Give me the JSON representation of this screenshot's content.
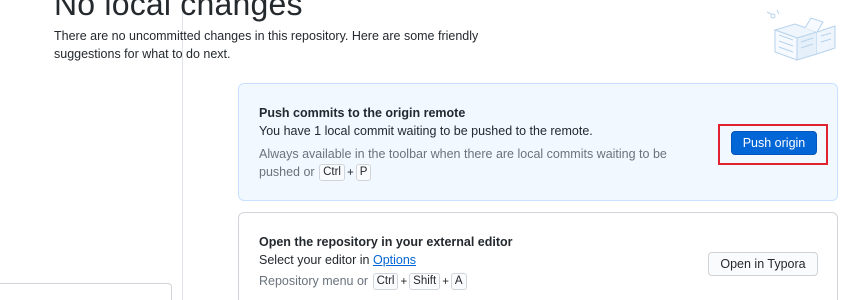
{
  "blank_slate": {
    "heading": "No local changes",
    "intro": "There are no uncommitted changes in this repository. Here are some friendly suggestions for what to do next."
  },
  "push_card": {
    "title": "Push commits to the origin remote",
    "description": "You have 1 local commit waiting to be pushed to the remote.",
    "hint_prefix": "Always available in the toolbar when there are local commits waiting to be pushed or",
    "shortcut_keys": [
      "Ctrl",
      "P"
    ],
    "button_label": "Push origin"
  },
  "editor_card": {
    "title": "Open the repository in your external editor",
    "select_prefix": "Select your editor in",
    "options_link": "Options",
    "menu_prefix": "Repository menu or",
    "shortcut_keys": [
      "Ctrl",
      "Shift",
      "A"
    ],
    "button_label": "Open in Typora"
  },
  "plus_symbol": "+",
  "colors": {
    "accent": "#0366d6",
    "push_card_bg": "#f1f8ff",
    "highlight": "#e0232e"
  }
}
